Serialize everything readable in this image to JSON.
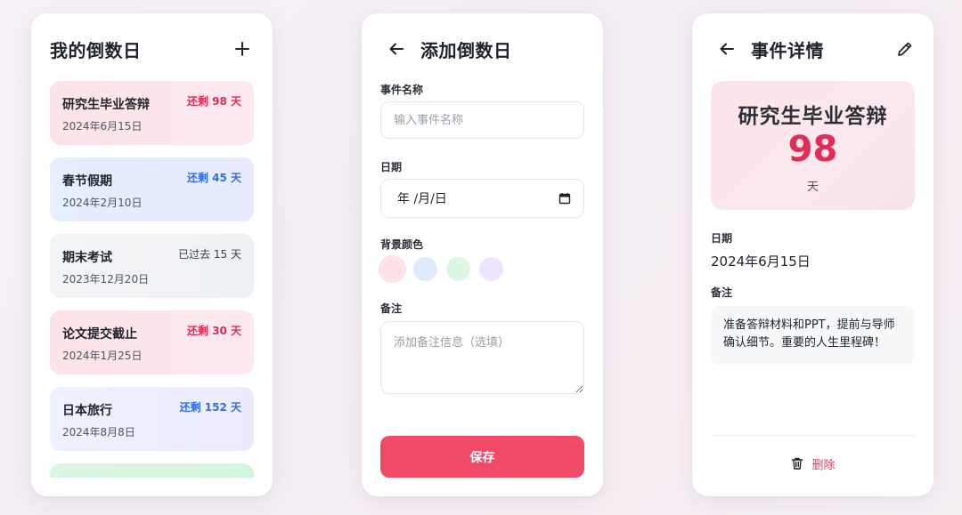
{
  "list": {
    "title": "我的倒数日",
    "add_icon": "plus-icon",
    "items": [
      {
        "name": "研究生毕业答辩",
        "date": "2024年6月15日",
        "badge": "还剩 98 天",
        "badge_color": "#e22b55"
      },
      {
        "name": "春节假期",
        "date": "2024年2月10日",
        "badge": "还剩 45 天",
        "badge_color": "#2f6fe0"
      },
      {
        "name": "期末考试",
        "date": "2023年12月20日",
        "badge": "已过去 15 天",
        "badge_color": "#3a3f47"
      },
      {
        "name": "论文提交截止",
        "date": "2024年1月25日",
        "badge": "还剩 30 天",
        "badge_color": "#e22b55"
      },
      {
        "name": "日本旅行",
        "date": "2024年8月8日",
        "badge": "还剩 152 天",
        "badge_color": "#2f6fe0"
      }
    ]
  },
  "add": {
    "title": "添加倒数日",
    "back_icon": "arrow-left-icon",
    "name_label": "事件名称",
    "name_placeholder": "输入事件名称",
    "date_label": "日期",
    "date_value": "年 /月/日",
    "color_label": "背景颜色",
    "colors": [
      "#fde0e4",
      "#dfeafd",
      "#dcf7e4",
      "#efe6fd"
    ],
    "note_label": "备注",
    "note_placeholder": "添加备注信息（选填）",
    "save_label": "保存"
  },
  "detail": {
    "title": "事件详情",
    "back_icon": "arrow-left-icon",
    "edit_icon": "pencil-icon",
    "hero_name": "研究生毕业答辩",
    "hero_count": "98",
    "hero_unit": "天",
    "date_label": "日期",
    "date_value": "2024年6月15日",
    "note_label": "备注",
    "note_text": "准备答辩材料和PPT，提前与导师确认细节。重要的人生里程碑！",
    "delete_label": "删除",
    "delete_icon": "trash-icon"
  },
  "colors": {
    "accent": "#f04a66",
    "danger_text": "#e03a55",
    "count_red": "#e22b55"
  }
}
